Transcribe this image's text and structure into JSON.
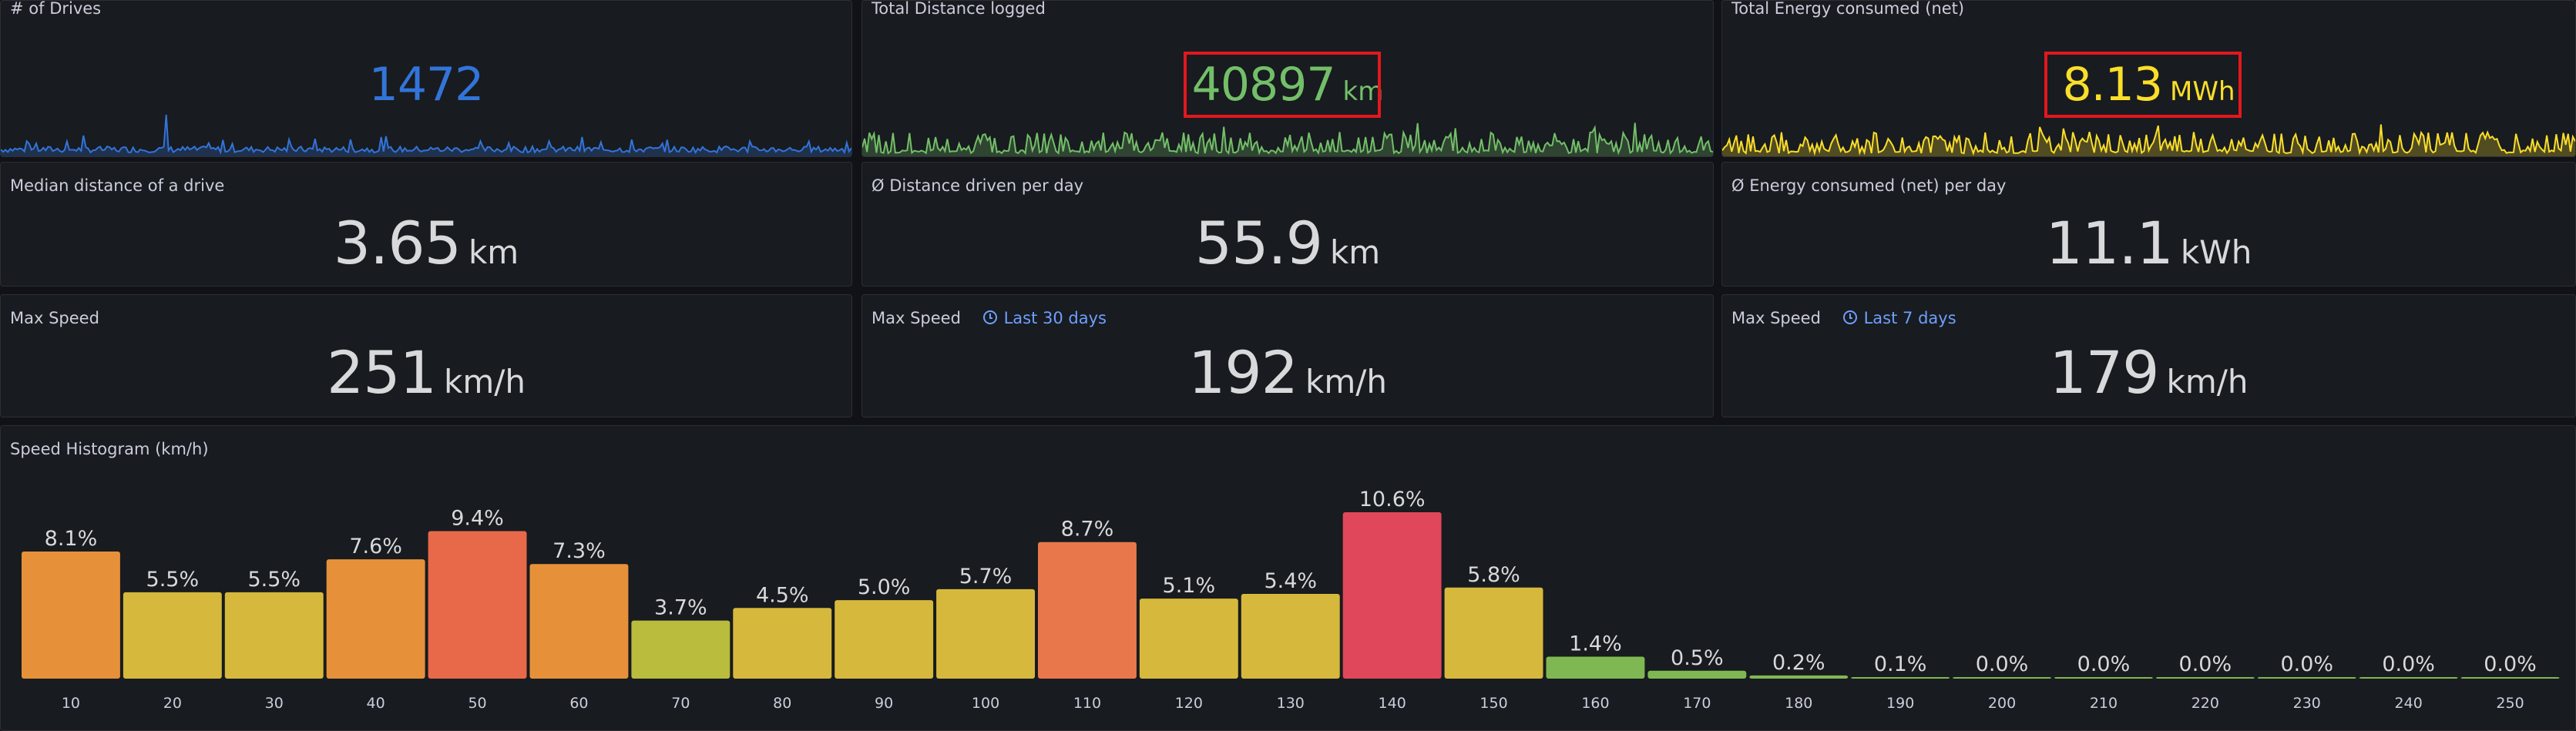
{
  "panels": {
    "drives": {
      "title": "# of Drives",
      "value": "1472",
      "color": "#3274d9"
    },
    "distance": {
      "title": "Total Distance logged",
      "value": "40897",
      "unit": "km",
      "color": "#73bf69"
    },
    "energy": {
      "title": "Total Energy consumed (net)",
      "value": "8.13",
      "unit": "MWh",
      "color": "#fade2a"
    },
    "median": {
      "title": "Median distance of a drive",
      "value": "3.65",
      "unit": "km"
    },
    "dist_day": {
      "title": "Ø Distance driven per day",
      "value": "55.9",
      "unit": "km"
    },
    "energy_day": {
      "title": "Ø Energy consumed (net) per day",
      "value": "11.1",
      "unit": "kWh"
    },
    "max_all": {
      "title": "Max Speed",
      "value": "251",
      "unit": "km/h"
    },
    "max_30": {
      "title": "Max Speed",
      "time": "Last 30 days",
      "value": "192",
      "unit": "km/h"
    },
    "max_7": {
      "title": "Max Speed",
      "time": "Last 7 days",
      "value": "179",
      "unit": "km/h"
    },
    "histogram": {
      "title": "Speed Histogram (km/h)"
    }
  },
  "chart_data": {
    "type": "bar",
    "title": "Speed Histogram (km/h)",
    "categories": [
      "10",
      "20",
      "30",
      "40",
      "50",
      "60",
      "70",
      "80",
      "90",
      "100",
      "110",
      "120",
      "130",
      "140",
      "150",
      "160",
      "170",
      "180",
      "190",
      "200",
      "210",
      "220",
      "230",
      "240",
      "250"
    ],
    "values": [
      8.1,
      5.5,
      5.5,
      7.6,
      9.4,
      7.3,
      3.7,
      4.5,
      5.0,
      5.7,
      8.7,
      5.1,
      5.4,
      10.6,
      5.8,
      1.4,
      0.5,
      0.2,
      0.1,
      0.0,
      0.0,
      0.0,
      0.0,
      0.0,
      0.0
    ],
    "labels": [
      "8.1%",
      "5.5%",
      "5.5%",
      "7.6%",
      "9.4%",
      "7.3%",
      "3.7%",
      "4.5%",
      "5.0%",
      "5.7%",
      "8.7%",
      "5.1%",
      "5.4%",
      "10.6%",
      "5.8%",
      "1.4%",
      "0.5%",
      "0.2%",
      "0.1%",
      "0.0%",
      "0.0%",
      "0.0%",
      "0.0%",
      "0.0%",
      "0.0%"
    ],
    "colors": [
      "#e6913a",
      "#d6b93c",
      "#d6b93c",
      "#e6913a",
      "#e8694a",
      "#e6913a",
      "#b9bc3c",
      "#d6b93c",
      "#d6b93c",
      "#d6b93c",
      "#e8784b",
      "#d6b93c",
      "#d6b93c",
      "#e0475a",
      "#d6b93c",
      "#7fb852",
      "#7fb852",
      "#7fb852",
      "#7fb852",
      "#7fb852",
      "#7fb852",
      "#7fb852",
      "#7fb852",
      "#7fb852",
      "#7fb852"
    ]
  }
}
